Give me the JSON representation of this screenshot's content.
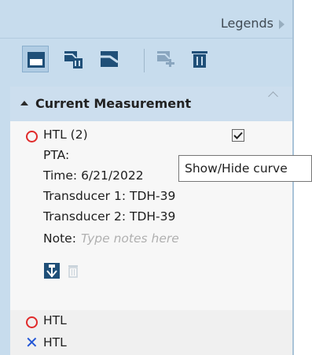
{
  "header": {
    "title": "Legends"
  },
  "toolbar": {
    "buttons": [
      {
        "name": "legend-view-icon",
        "active": true
      },
      {
        "name": "delete-curve-icon",
        "active": false
      },
      {
        "name": "collapse-icon",
        "active": false
      },
      {
        "name": "add-curve-icon",
        "active": false,
        "disabled": true
      },
      {
        "name": "trash-icon",
        "active": false
      }
    ]
  },
  "group": {
    "title": "Current Measurement",
    "items": [
      {
        "symbol": "circle-red",
        "label": "HTL (2)",
        "checked": true,
        "pta_label": "PTA:",
        "time": "Time: 6/21/2022",
        "transducer1": "Transducer 1:  TDH-39",
        "transducer2": "Transducer 2:  TDH-39",
        "note_label": "Note:",
        "note_placeholder": "Type notes here"
      },
      {
        "symbol": "circle-red",
        "label": "HTL"
      },
      {
        "symbol": "x-blue",
        "label": "HTL"
      }
    ]
  },
  "tooltip": {
    "text": "Show/Hide curve"
  },
  "colors": {
    "panel_bg": "#c7dced",
    "red_marker": "#e02a2a",
    "blue_marker": "#2256d6"
  }
}
